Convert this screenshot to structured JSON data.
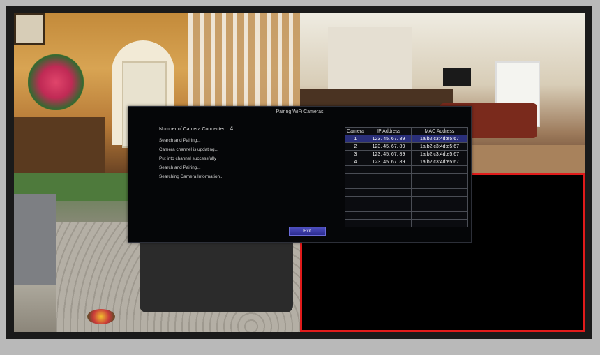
{
  "dialog": {
    "title": "Pairing WiFi Cameras",
    "count_label": "Number of Camera Connected:",
    "count_value": "4",
    "log": [
      "Search and Pairing...",
      "Camera channel is updating...",
      "Put into channel successfully",
      "Search and Pairing...",
      "Searching Camera Information..."
    ],
    "table": {
      "headers": [
        "Camera",
        "IP Address",
        "MAC Address"
      ],
      "rows": [
        {
          "camera": "1",
          "ip": "123. 45. 67. 89",
          "mac": "1a:b2:c3:4d:e5:67"
        },
        {
          "camera": "2",
          "ip": "123. 45. 67. 89",
          "mac": "1a:b2:c3:4d:e5:67"
        },
        {
          "camera": "3",
          "ip": "123. 45. 67. 89",
          "mac": "1a:b2:c3:4d:e5:67"
        },
        {
          "camera": "4",
          "ip": "123. 45. 67. 89",
          "mac": "1a:b2:c3:4d:e5:67"
        }
      ]
    },
    "exit_label": "Exit"
  },
  "colors": {
    "selection": "#2a2f7a",
    "exit_button": "#3a3ba8",
    "active_tile_border": "#e01b1b"
  }
}
